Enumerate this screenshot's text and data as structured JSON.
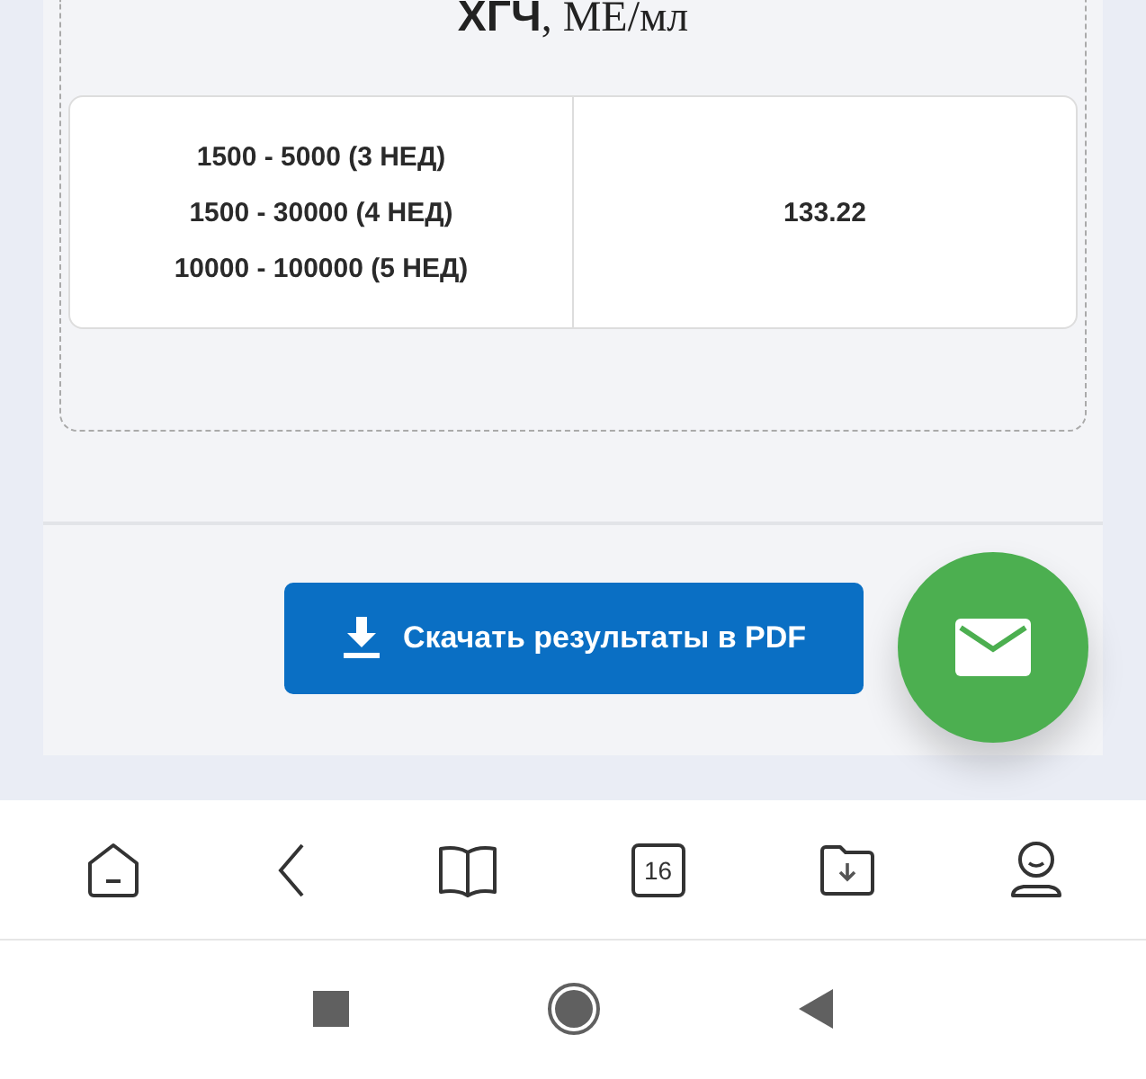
{
  "result_card": {
    "title": "**ХГЧ**, МЕ/мл",
    "norm_ranges": [
      "1500 - 5000 (3 НЕД)",
      "1500 - 30000 (4 НЕД)",
      "10000 - 100000 (5 НЕД)"
    ],
    "value": "133.22"
  },
  "download_button": {
    "label": "Скачать результаты в PDF"
  },
  "bottom_nav": [
    {
      "kind": "home"
    },
    {
      "kind": "back"
    },
    {
      "kind": "book"
    },
    {
      "kind": "calendar",
      "text": "16"
    },
    {
      "kind": "folder"
    },
    {
      "kind": "profile"
    }
  ],
  "system_nav": [
    {
      "kind": "recents"
    },
    {
      "kind": "home"
    },
    {
      "kind": "back"
    }
  ]
}
